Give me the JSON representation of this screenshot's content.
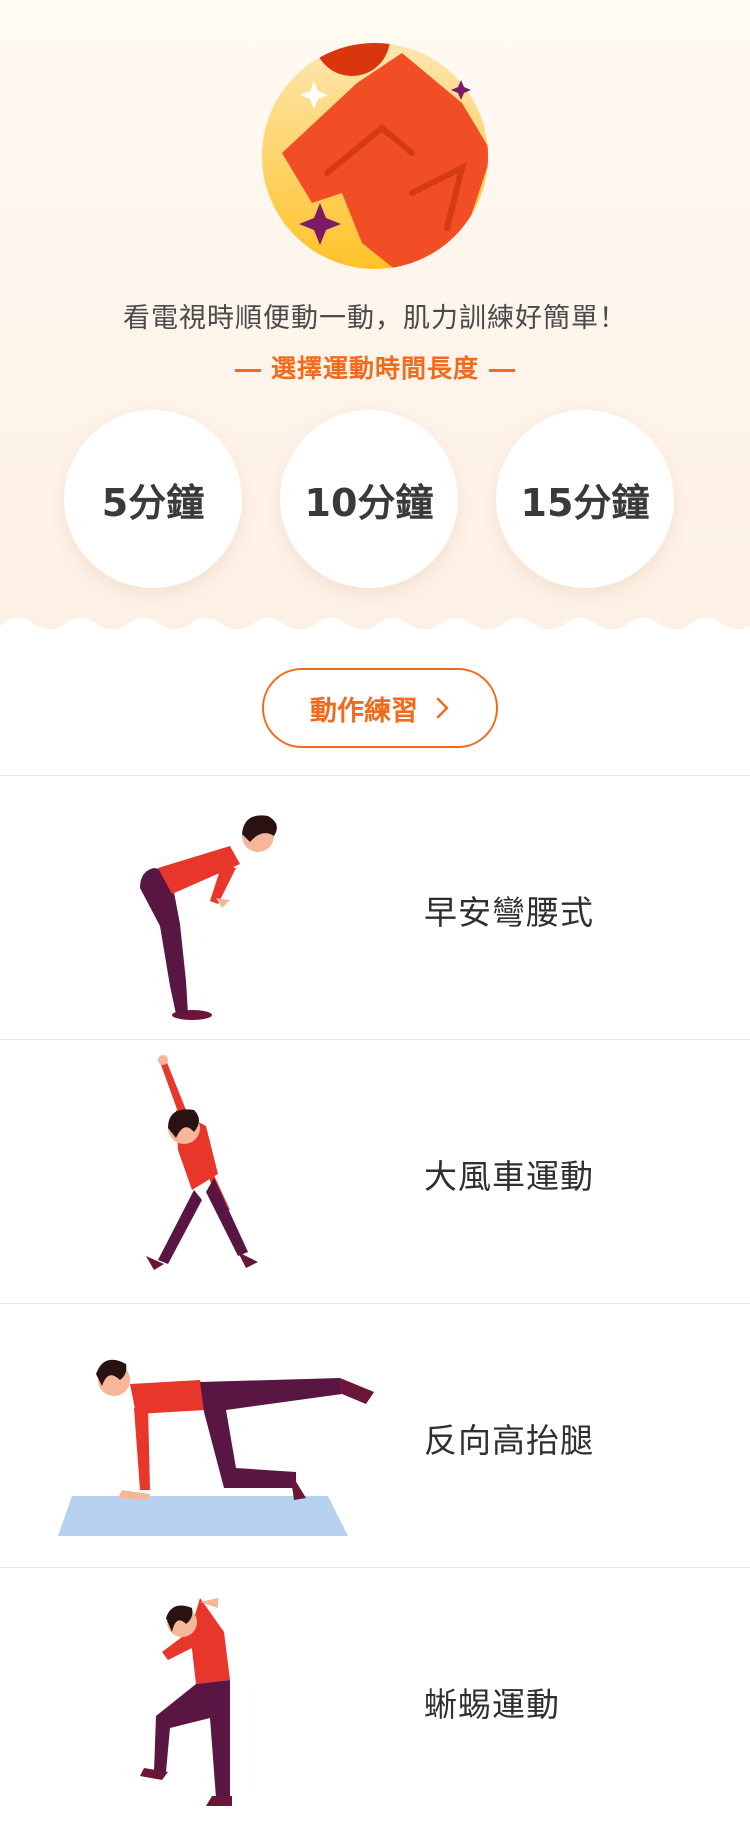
{
  "hero": {
    "tagline": "看電視時順便動一動，肌力訓練好簡單！",
    "subtitle": "選擇運動時間長度",
    "colors": {
      "accent": "#f26b1d",
      "background": "#fdf3ea"
    }
  },
  "durations": [
    {
      "label": "5分鐘"
    },
    {
      "label": "10分鐘"
    },
    {
      "label": "15分鐘"
    }
  ],
  "practice_button": {
    "label": "動作練習",
    "icon": "chevron-right-icon"
  },
  "exercises": [
    {
      "name": "早安彎腰式"
    },
    {
      "name": "大風車運動"
    },
    {
      "name": "反向高抬腿"
    },
    {
      "name": "蜥蜴運動"
    }
  ]
}
